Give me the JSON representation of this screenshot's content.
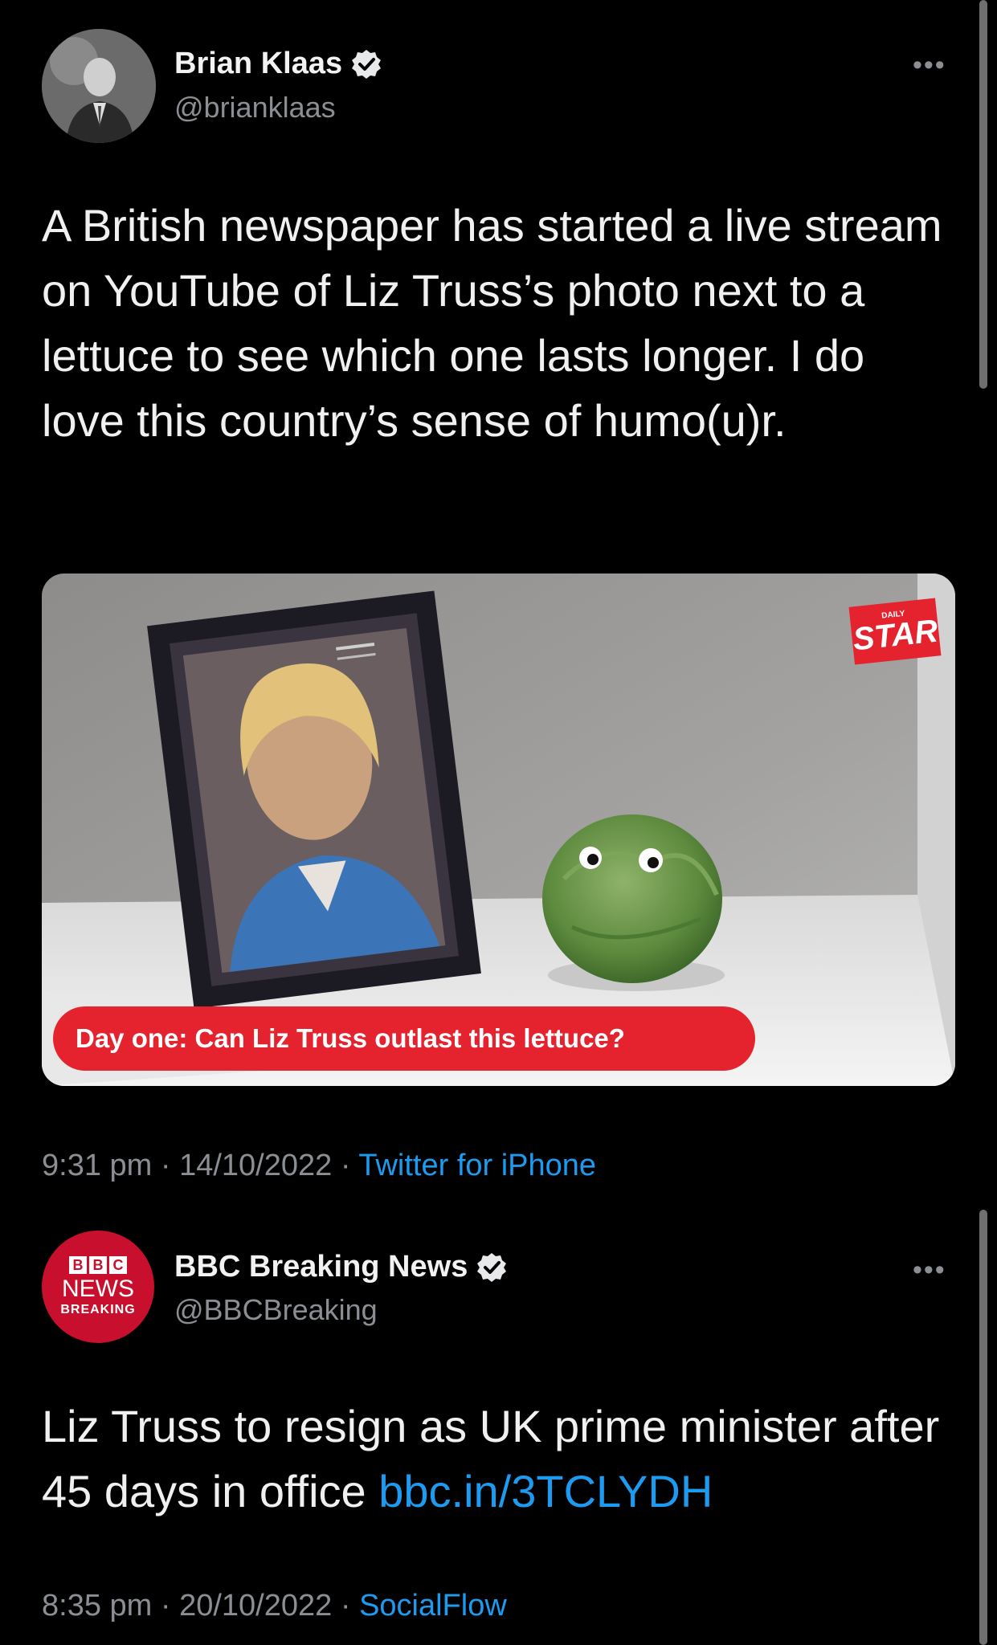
{
  "tweets": [
    {
      "author": "Brian Klaas",
      "handle": "@brianklaas",
      "more": "•••",
      "text": "A British newspaper has started a live stream on YouTube of Liz Truss’s photo next to a lettuce to see which one lasts longer. I do love this country’s sense of humo(u)r.",
      "media": {
        "caption": "Day one: Can Liz Truss outlast this lettuce?",
        "logo_small": "DAILY",
        "logo_big": "STAR"
      },
      "time": "9:31 pm",
      "date": "14/10/2022",
      "source": "Twitter for iPhone"
    },
    {
      "author": "BBC Breaking News",
      "handle": "@BBCBreaking",
      "more": "•••",
      "avatar": {
        "b1": "B",
        "b2": "B",
        "b3": "C",
        "news": "NEWS",
        "breaking": "BREAKING"
      },
      "text": "Liz Truss to resign as UK prime minister after 45 days in office",
      "link": "bbc.in/3TCLYDH",
      "time": "8:35 pm",
      "date": "20/10/2022",
      "source": "SocialFlow"
    }
  ],
  "colors": {
    "background": "#000000",
    "link": "#1d9bf0",
    "caption_red": "#e5232f",
    "bbc_red": "#c8102e"
  }
}
